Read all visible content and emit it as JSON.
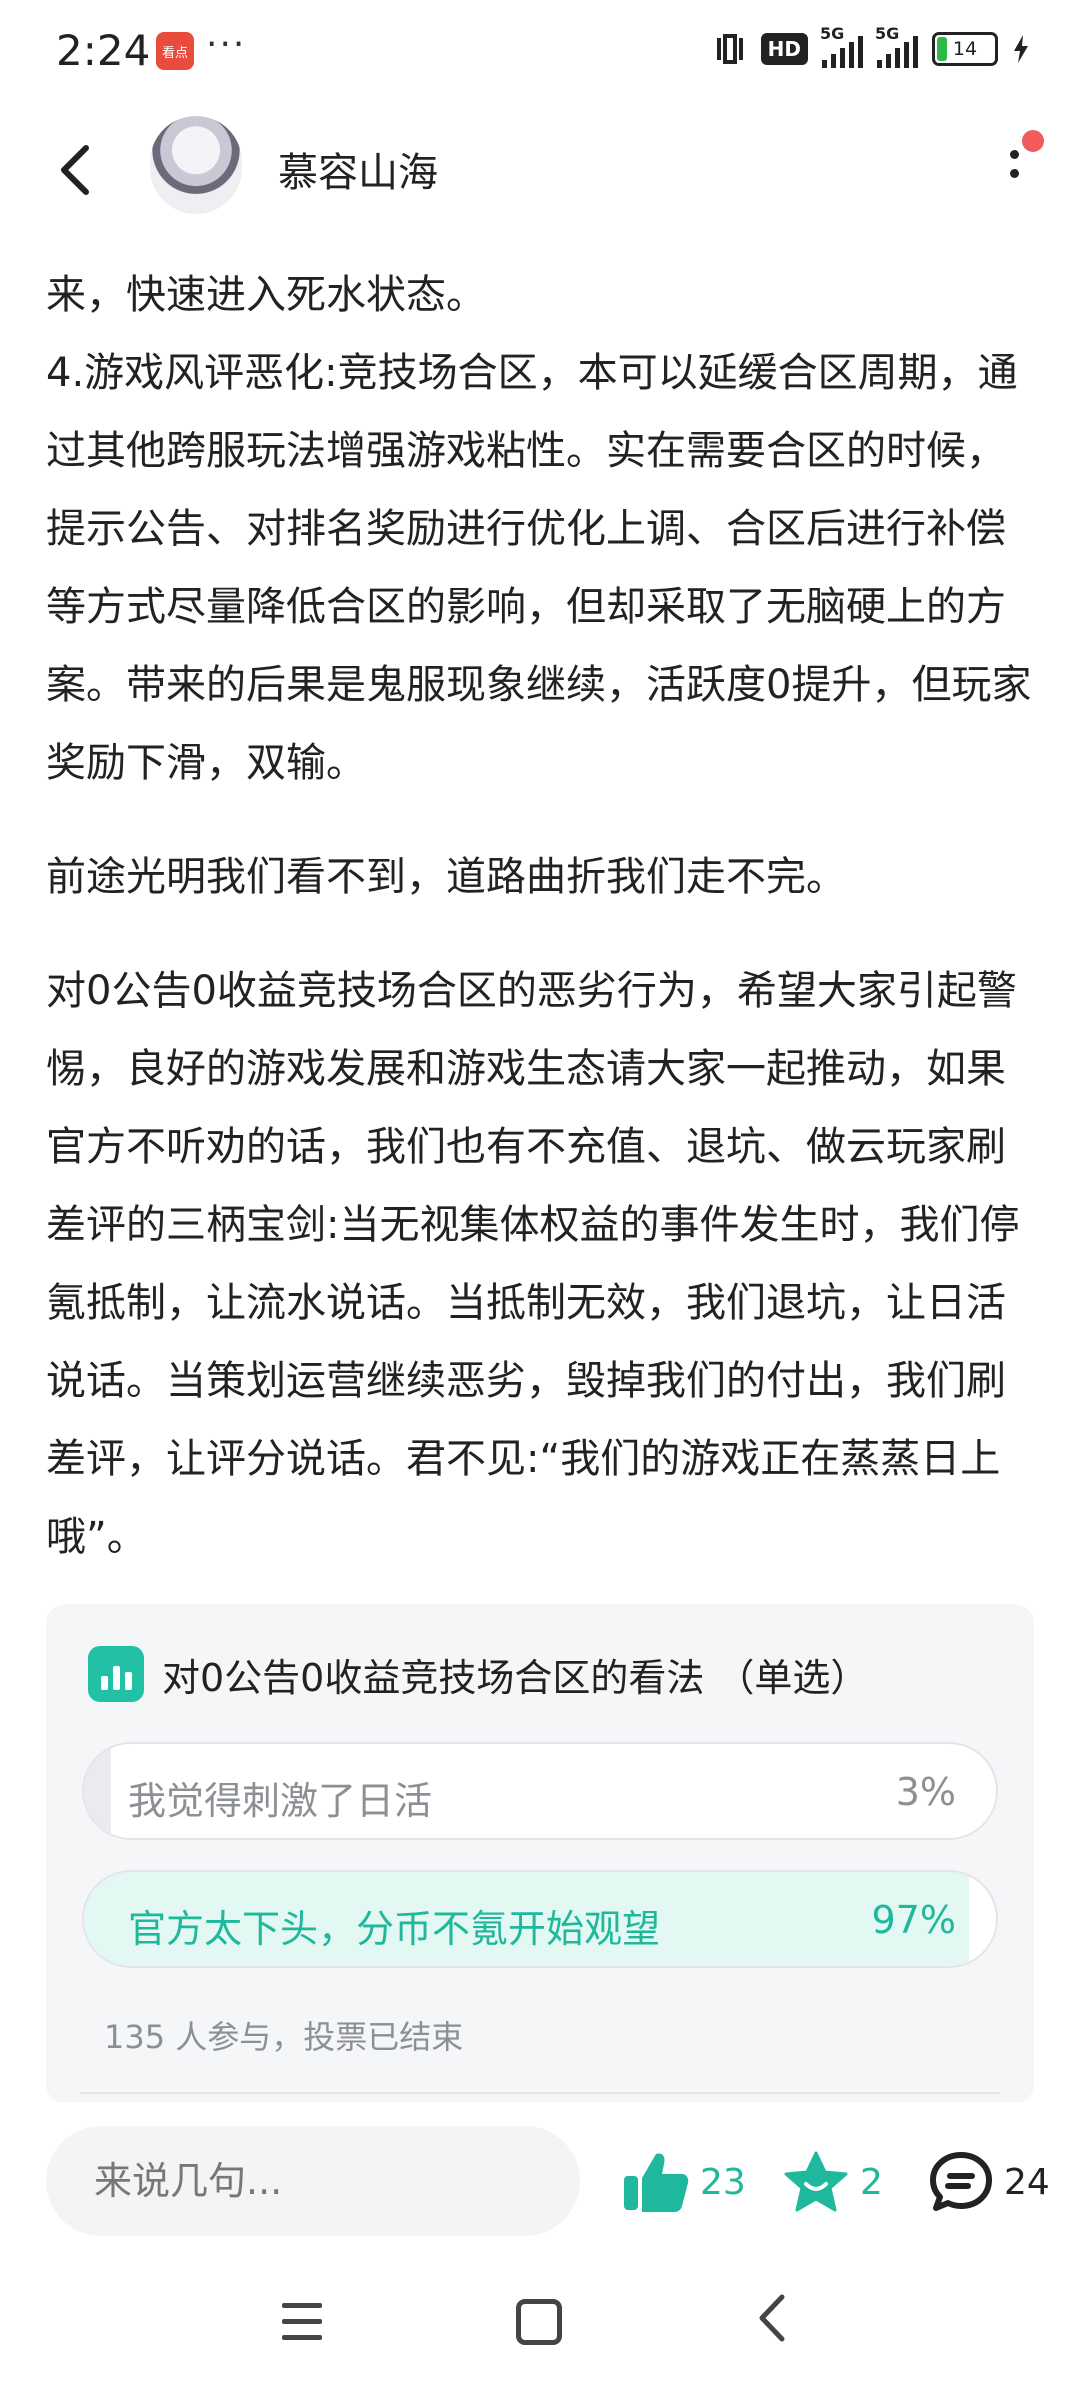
{
  "status_bar": {
    "time": "2:24",
    "app_badge": "看点",
    "more_dots": "···",
    "hd_label": "HD",
    "signal1_label": "5G",
    "signal2_label": "5G",
    "battery": "14"
  },
  "header": {
    "author_name": "慕容山海"
  },
  "article": {
    "paragraphs": [
      "来，快速进入死水状态。",
      "4.游戏风评恶化:竞技场合区，本可以延缓合区周期，通过其他跨服玩法增强游戏粘性。实在需要合区的时候，提示公告、对排名奖励进行优化上调、合区后进行补偿等方式尽量降低合区的影响，但却采取了无脑硬上的方案。带来的后果是鬼服现象继续，活跃度0提升，但玩家奖励下滑，双输。",
      "前途光明我们看不到，道路曲折我们走不完。",
      "对0公告0收益竞技场合区的恶劣行为，希望大家引起警惕，良好的游戏发展和游戏生态请大家一起推动，如果官方不听劝的话，我们也有不充值、退坑、做云玩家刷差评的三柄宝剑:当无视集体权益的事件发生时，我们停氪抵制，让流水说话。当抵制无效，我们退坑，让日活说话。当策划运营继续恶劣，毁掉我们的付出，我们刷差评，让评分说话。君不见:“我们的游戏正在蒸蒸日上哦”。"
    ]
  },
  "poll": {
    "title": "对0公告0收益竞技场合区的看法 （单选）",
    "options": [
      {
        "label": "我觉得刺激了日活",
        "percent_text": "3%",
        "fraction": 0.03
      },
      {
        "label": "官方太下头，分币不氪开始观望",
        "percent_text": "97%",
        "fraction": 0.97
      }
    ],
    "footer": "135 人参与，投票已结束"
  },
  "bottom_bar": {
    "comment_placeholder": "来说几句...",
    "like_count": "23",
    "favorite_count": "2",
    "comment_count": "24"
  },
  "colors": {
    "accent": "#1fb89c",
    "notification_dot": "#f25b5b"
  },
  "icons": [
    "back-arrow-icon",
    "more-vertical-icon",
    "poll-chart-icon",
    "thumbs-up-icon",
    "star-badge-icon",
    "comment-bubble-icon",
    "nav-menu-icon",
    "nav-home-icon",
    "nav-back-icon"
  ]
}
